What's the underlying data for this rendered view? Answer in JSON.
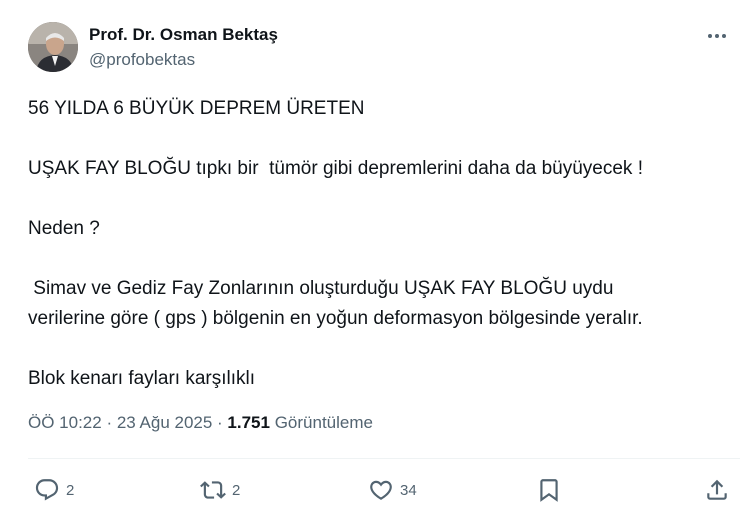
{
  "author": {
    "name": "Prof. Dr. Osman Bektaş",
    "handle": "@profobektas"
  },
  "tweet": {
    "lines": [
      "56 YILDA 6 BÜYÜK DEPREM ÜRETEN",
      "UŞAK FAY BLOĞU tıpkı bir  tümör gibi depremlerini daha da büyüyecek !",
      "Neden ?",
      " Simav ve Gediz Fay Zonlarının oluşturduğu UŞAK FAY BLOĞU uydu",
      "verilerine göre ( gps ) bölgenin en yoğun deformasyon bölgesinde yeralır.",
      "Blok kenarı fayları karşılıklı"
    ]
  },
  "meta": {
    "time": "ÖÖ 10:22",
    "separator": " · ",
    "date": "23 Ağu 2025",
    "views_count": "1.751",
    "views_label": "Görüntüleme"
  },
  "actions": {
    "reply_count": "2",
    "retweet_count": "2",
    "like_count": "34"
  },
  "icons": {
    "more": "more-horizontal-icon",
    "reply": "reply-icon",
    "retweet": "retweet-icon",
    "like": "heart-icon",
    "bookmark": "bookmark-icon",
    "share": "share-icon"
  },
  "colors": {
    "text": "#0f1419",
    "secondary": "#536471",
    "divider": "#eff3f4"
  }
}
